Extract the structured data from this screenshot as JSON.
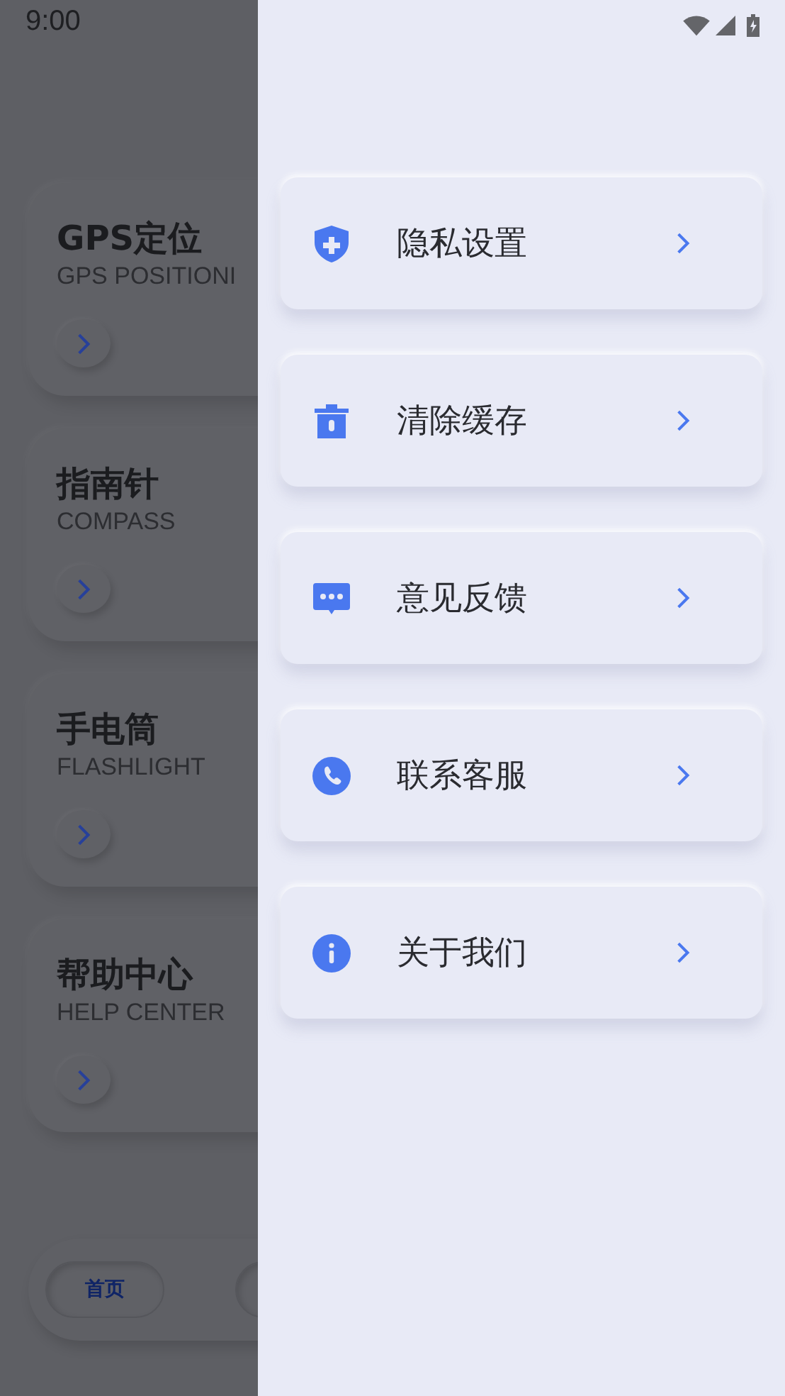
{
  "status_bar": {
    "time": "9:00"
  },
  "background_cards": [
    {
      "title": "GPS定位",
      "subtitle": "GPS POSITIONI"
    },
    {
      "title": "指南针",
      "subtitle": "COMPASS"
    },
    {
      "title": "手电筒",
      "subtitle": "FLASHLIGHT"
    },
    {
      "title": "帮助中心",
      "subtitle": "HELP CENTER"
    }
  ],
  "bottom_nav": [
    {
      "label": "首页"
    }
  ],
  "drawer": {
    "items": [
      {
        "label": "隐私设置"
      },
      {
        "label": "清除缓存"
      },
      {
        "label": "意见反馈"
      },
      {
        "label": "联系客服"
      },
      {
        "label": "关于我们"
      }
    ]
  }
}
